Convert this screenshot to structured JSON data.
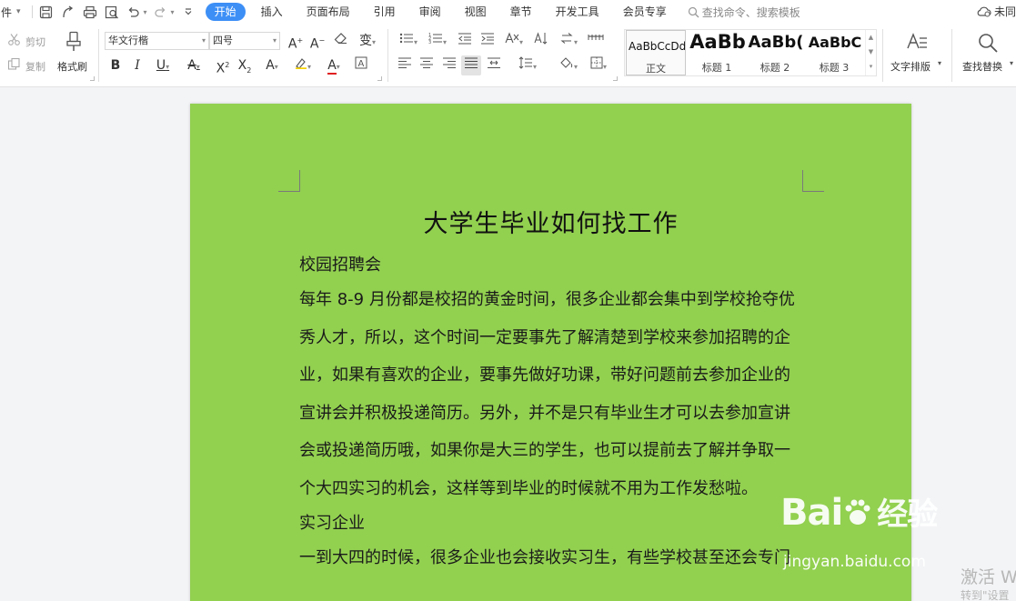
{
  "menubar": {
    "file_label": "件",
    "tabs": [
      "开始",
      "插入",
      "页面布局",
      "引用",
      "审阅",
      "视图",
      "章节",
      "开发工具",
      "会员专享"
    ],
    "search_placeholder": "查找命令、搜索模板",
    "cloud_label": "未同"
  },
  "ribbon": {
    "cut": "剪切",
    "copy": "复制",
    "format_painter": "格式刷",
    "font_name": "华文行楷",
    "font_size": "四号",
    "styles": [
      {
        "sample": "AaBbCcDd",
        "label": "正文"
      },
      {
        "sample": "AaBb",
        "label": "标题 1"
      },
      {
        "sample": "AaBb(",
        "label": "标题 2"
      },
      {
        "sample": "AaBbC",
        "label": "标题 3"
      }
    ],
    "text_layout": "文字排版",
    "find_replace": "查找替换"
  },
  "document": {
    "title": "大学生毕业如何找工作",
    "heading1": "校园招聘会",
    "para1_lines": [
      "每年 8-9 月份都是校招的黄金时间，很多企业都会集中到学校抢夺优",
      "秀人才，所以，这个时间一定要事先了解清楚到学校来参加招聘的企",
      "业，如果有喜欢的企业，要事先做好功课，带好问题前去参加企业的",
      "宣讲会并积极投递简历。另外，并不是只有毕业生才可以去参加宣讲",
      "会或投递简历哦，如果你是大三的学生，也可以提前去了解并争取一",
      "个大四实习的机会，这样等到毕业的时候就不用为工作发愁啦。"
    ],
    "heading2": "实习企业",
    "para2_lines": [
      "一到大四的时候，很多企业也会接收实习生，有些学校甚至还会专门"
    ]
  },
  "watermark": {
    "logo": "Bai",
    "logo_cn": "经验",
    "url": "jingyan.baidu.com",
    "activate_line1": "激活 W",
    "activate_line2": "转到\"设置"
  },
  "colors": {
    "page_bg": "#92d050",
    "active_tab": "#3d8ff6"
  }
}
